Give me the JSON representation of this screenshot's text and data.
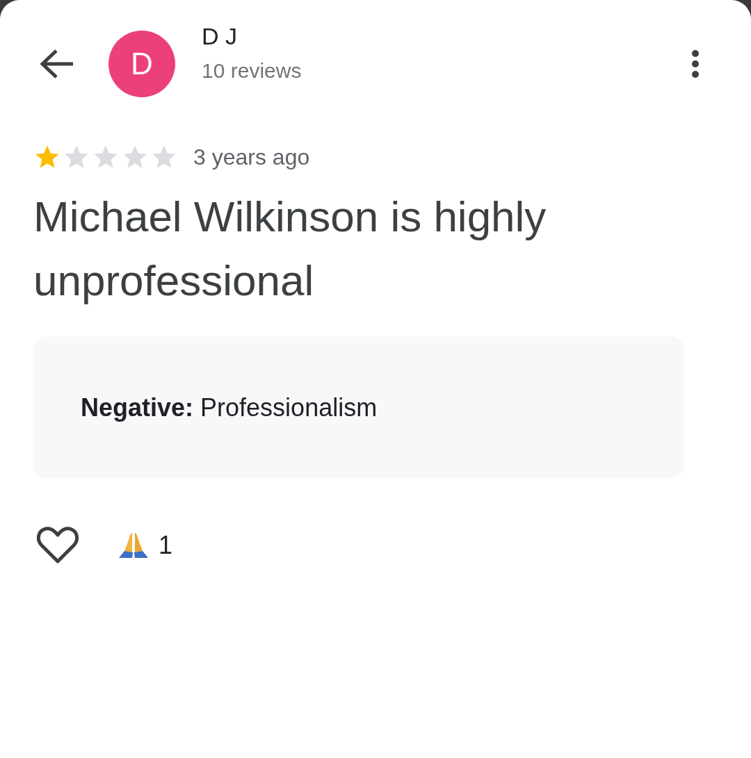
{
  "reviewer": {
    "avatar_letter": "D",
    "name": "D J",
    "review_count": "10 reviews"
  },
  "review": {
    "stars": 1,
    "time": "3 years ago",
    "title": "Michael Wilkinson is highly unprofessional",
    "attributes": "**Negative:** Professionalism"
  },
  "reactions": {
    "liked": false,
    "count": "1"
  }
}
